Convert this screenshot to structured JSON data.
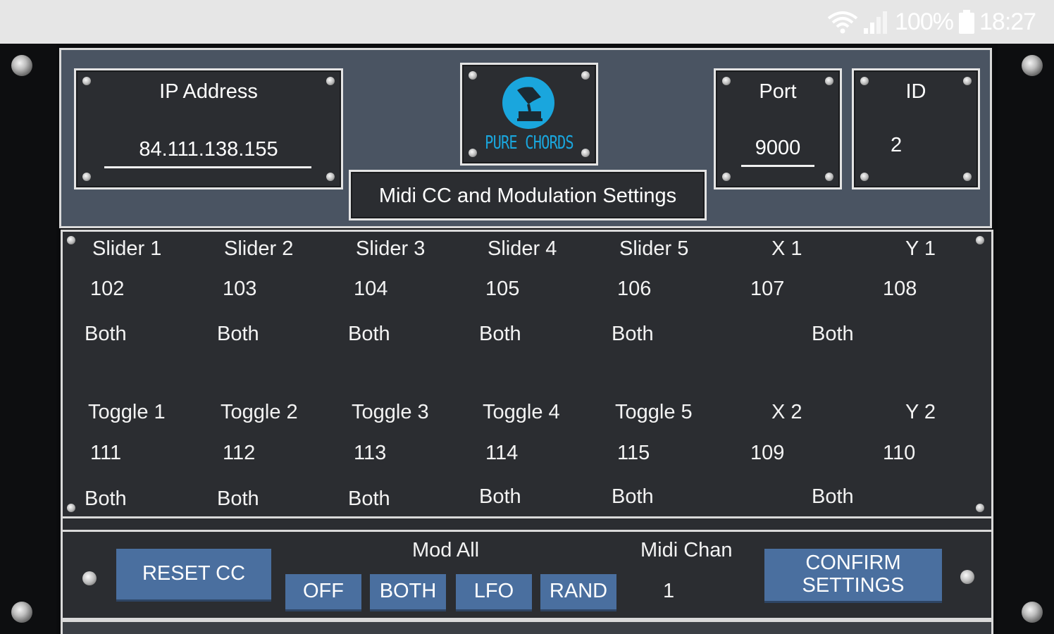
{
  "status_bar": {
    "battery_text": "100%",
    "time": "18:27",
    "icons": [
      "wifi-icon",
      "signal-icon",
      "battery-icon"
    ]
  },
  "header": {
    "ip": {
      "label": "IP Address",
      "value": "84.111.138.155"
    },
    "logo": {
      "text": "PURE CHORDS",
      "icon": "gramophone-icon"
    },
    "title": "Midi CC and Modulation Settings",
    "port": {
      "label": "Port",
      "value": "9000"
    },
    "id": {
      "label": "ID",
      "value": "2"
    }
  },
  "grid": {
    "row1_names": [
      "Slider 1",
      "Slider 2",
      "Slider 3",
      "Slider 4",
      "Slider 5",
      "X 1",
      "Y 1"
    ],
    "row1_cc": [
      "102",
      "103",
      "104",
      "105",
      "106",
      "107",
      "108"
    ],
    "row1_mode": [
      "Both",
      "Both",
      "Both",
      "Both",
      "Both",
      "Both"
    ],
    "row2_names": [
      "Toggle 1",
      "Toggle 2",
      "Toggle 3",
      "Toggle 4",
      "Toggle 5",
      "X 2",
      "Y 2"
    ],
    "row2_cc": [
      "111",
      "112",
      "113",
      "114",
      "115",
      "109",
      "110"
    ],
    "row2_mode": [
      "Both",
      "Both",
      "Both",
      "Both",
      "Both",
      "Both"
    ]
  },
  "controls": {
    "reset_label": "RESET CC",
    "mod_all_label": "Mod All",
    "mod_buttons": [
      "OFF",
      "BOTH",
      "LFO",
      "RAND"
    ],
    "midi_chan_label": "Midi Chan",
    "midi_chan_value": "1",
    "confirm_line1": "CONFIRM",
    "confirm_line2": "SETTINGS"
  },
  "colors": {
    "button_blue": "#4a6f9f",
    "panel_dark": "#2b2d31",
    "header_slate": "#4a5462",
    "logo_cyan": "#1aa6dd"
  }
}
